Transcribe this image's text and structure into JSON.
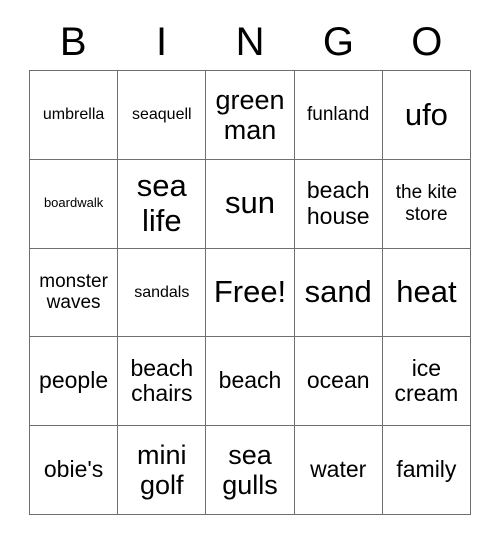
{
  "card": {
    "header": {
      "letters": [
        "B",
        "I",
        "N",
        "G",
        "O"
      ]
    },
    "columns": [
      "B",
      "I",
      "N",
      "G",
      "O"
    ],
    "rows": [
      [
        {
          "label": "umbrella",
          "size": "sm"
        },
        {
          "label": "seaquell",
          "size": "sm"
        },
        {
          "label": "green man",
          "size": "xl"
        },
        {
          "label": "funland",
          "size": "md"
        },
        {
          "label": "ufo",
          "size": "xxl"
        }
      ],
      [
        {
          "label": "boardwalk",
          "size": "xs"
        },
        {
          "label": "sea life",
          "size": "xxl"
        },
        {
          "label": "sun",
          "size": "xxl"
        },
        {
          "label": "beach house",
          "size": "lg"
        },
        {
          "label": "the kite store",
          "size": "md"
        }
      ],
      [
        {
          "label": "monster waves",
          "size": "md"
        },
        {
          "label": "sandals",
          "size": "sm"
        },
        {
          "label": "Free!",
          "size": "xxl"
        },
        {
          "label": "sand",
          "size": "xxl"
        },
        {
          "label": "heat",
          "size": "xxl"
        }
      ],
      [
        {
          "label": "people",
          "size": "lg"
        },
        {
          "label": "beach chairs",
          "size": "lg"
        },
        {
          "label": "beach",
          "size": "lg"
        },
        {
          "label": "ocean",
          "size": "lg"
        },
        {
          "label": "ice cream",
          "size": "lg"
        }
      ],
      [
        {
          "label": "obie's",
          "size": "lg"
        },
        {
          "label": "mini golf",
          "size": "xl"
        },
        {
          "label": "sea gulls",
          "size": "xl"
        },
        {
          "label": "water",
          "size": "lg"
        },
        {
          "label": "family",
          "size": "lg"
        }
      ]
    ],
    "free_space": {
      "label": "Free!",
      "row": 2,
      "col": 2
    },
    "colors": {
      "background": "#ffffff",
      "text": "#000000",
      "grid_line": "#6f6f6f"
    }
  }
}
